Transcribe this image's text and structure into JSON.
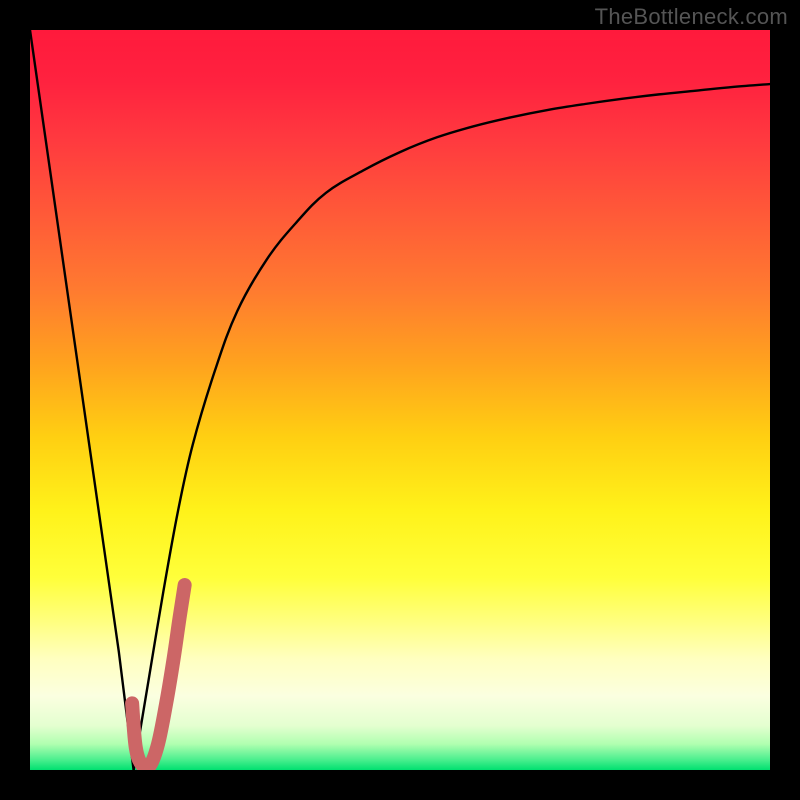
{
  "watermark": "TheBottleneck.com",
  "colors": {
    "black": "#000000",
    "curve_stroke": "#000000",
    "highlight_stroke": "#cc6666",
    "watermark_text": "#555555",
    "gradient_stops": [
      {
        "offset": 0.0,
        "color": "#ff1a3c"
      },
      {
        "offset": 0.07,
        "color": "#ff223f"
      },
      {
        "offset": 0.15,
        "color": "#ff3a3f"
      },
      {
        "offset": 0.25,
        "color": "#ff5a38"
      },
      {
        "offset": 0.35,
        "color": "#ff7a30"
      },
      {
        "offset": 0.45,
        "color": "#ffa21e"
      },
      {
        "offset": 0.55,
        "color": "#ffcf12"
      },
      {
        "offset": 0.65,
        "color": "#fff21a"
      },
      {
        "offset": 0.74,
        "color": "#ffff3a"
      },
      {
        "offset": 0.8,
        "color": "#ffff80"
      },
      {
        "offset": 0.85,
        "color": "#ffffc0"
      },
      {
        "offset": 0.9,
        "color": "#fbffe0"
      },
      {
        "offset": 0.94,
        "color": "#e4ffd0"
      },
      {
        "offset": 0.965,
        "color": "#b0ffb0"
      },
      {
        "offset": 0.985,
        "color": "#50f090"
      },
      {
        "offset": 1.0,
        "color": "#00e070"
      }
    ]
  },
  "chart_data": {
    "type": "line",
    "title": "",
    "xlabel": "",
    "ylabel": "",
    "xlim": [
      0,
      100
    ],
    "ylim": [
      0,
      100
    ],
    "grid": false,
    "legend": false,
    "series": [
      {
        "name": "left-curve",
        "x": [
          0,
          2,
          4,
          6,
          8,
          10,
          12,
          13,
          14
        ],
        "y": [
          100,
          86,
          72,
          58,
          44,
          30,
          16,
          8,
          0
        ]
      },
      {
        "name": "right-curve",
        "x": [
          14,
          16,
          18,
          20,
          22,
          25,
          28,
          32,
          36,
          40,
          45,
          50,
          55,
          60,
          65,
          70,
          75,
          80,
          85,
          90,
          95,
          100
        ],
        "y": [
          0,
          12,
          24,
          35,
          44,
          54,
          62,
          69,
          74,
          78,
          81,
          83.5,
          85.5,
          87,
          88.2,
          89.2,
          90,
          90.7,
          91.3,
          91.8,
          92.3,
          92.7
        ]
      },
      {
        "name": "highlight-j",
        "x": [
          13.8,
          14.3,
          15.2,
          16.2,
          17.3,
          18.4,
          19.4,
          20.2,
          20.9
        ],
        "y": [
          9.0,
          3.0,
          0.6,
          0.6,
          3.5,
          9.0,
          15.0,
          20.5,
          25.0
        ]
      }
    ],
    "annotations": []
  }
}
